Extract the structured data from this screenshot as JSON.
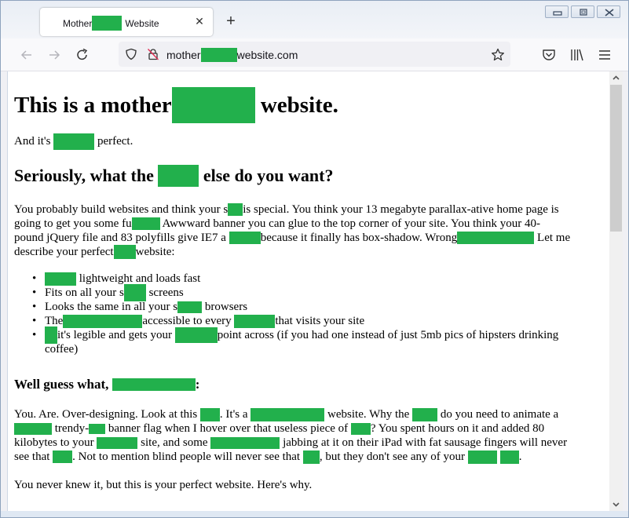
{
  "browser": {
    "tab": {
      "title_prefix": "Mother",
      "title_suffix": "Website",
      "close_glyph": "✕"
    },
    "new_tab_glyph": "+",
    "url": {
      "prefix": "mother",
      "suffix": "website.com"
    },
    "icons": {
      "back": "back-arrow-icon",
      "forward": "forward-arrow-icon",
      "reload": "reload-icon",
      "shield": "tracking-protection-shield-icon",
      "lock": "insecure-lock-icon",
      "star": "bookmark-star-icon",
      "pocket": "pocket-icon",
      "library": "library-icon",
      "menu": "hamburger-menu-icon"
    },
    "window_controls": [
      "minimize",
      "maximize",
      "close"
    ],
    "redaction_color": "#22b04c"
  },
  "page": {
    "h1": {
      "before": "This is a mother",
      "after": " website."
    },
    "intro": {
      "before": "And it's ",
      "after": " perfect."
    },
    "h2_seriously": {
      "before": "Seriously, what the ",
      "after": " else do you want?"
    },
    "para1": {
      "l1a": "You probably build websites and think your s",
      "l1b": "is special. You think your 13 megabyte parallax-ative home page is",
      "l2a": "going to get you some fu",
      "l2b": " Awwward banner you can glue to the top corner of your site. You think your 40-",
      "l3a": "pound jQuery file and 83 polyfills give IE7 a ",
      "l3b": "because it finally has box-shadow. Wrong",
      "l3c": " Let me",
      "l4a": "describe your perfect",
      "l4b": "website:"
    },
    "list": [
      {
        "before": "",
        "after": " lightweight and loads fast"
      },
      {
        "before": "Fits on all your s",
        "after": " screens"
      },
      {
        "before": "Looks the same in all your s",
        "after": " browsers"
      },
      {
        "before": "The",
        "mid": "accessible to every ",
        "after": "that visits your site"
      },
      {
        "before": "",
        "mid": "it's legible and gets your ",
        "after": "point across (if you had one instead of just 5mb pics of hipsters drinking",
        "wrap": "coffee)"
      }
    ],
    "h3_well": {
      "before": "Well guess what, ",
      "after": ":"
    },
    "para2": {
      "l1a": "You. Are. Over-designing. Look at this ",
      "l1b": ". It's a ",
      "l1c": " website. Why the ",
      "l1d": " do you need to animate a",
      "l2a": " trendy-",
      "l2b": " banner flag when I hover over that useless piece of ",
      "l2c": "? You spent hours on it and added 80",
      "l3a": "kilobytes to your ",
      "l3b": " site, and some ",
      "l3c": " jabbing at it on their iPad with fat sausage fingers will never",
      "l4a": "see that ",
      "l4b": ". Not to mention blind people will never see that ",
      "l4c": ", but they don't see any of your ",
      "l4d": "."
    },
    "para3": "You never knew it, but this is your perfect website. Here's why."
  }
}
